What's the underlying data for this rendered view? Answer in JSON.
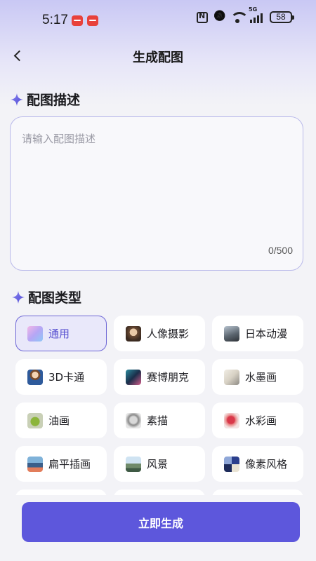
{
  "status_bar": {
    "time": "5:17",
    "battery": "58",
    "network": "5G"
  },
  "header": {
    "title": "生成配图"
  },
  "description": {
    "section_title": "配图描述",
    "placeholder": "请输入配图描述",
    "value": "",
    "char_count": "0/500"
  },
  "types": {
    "section_title": "配图类型",
    "selected": "通用",
    "items": [
      {
        "label": "通用",
        "icon": "general-icon"
      },
      {
        "label": "人像摄影",
        "icon": "portrait-thumb"
      },
      {
        "label": "日本动漫",
        "icon": "anime-thumb"
      },
      {
        "label": "3D卡通",
        "icon": "cartoon-3d-thumb"
      },
      {
        "label": "赛博朋克",
        "icon": "cyberpunk-thumb"
      },
      {
        "label": "水墨画",
        "icon": "ink-wash-thumb"
      },
      {
        "label": "油画",
        "icon": "oil-painting-thumb"
      },
      {
        "label": "素描",
        "icon": "sketch-thumb"
      },
      {
        "label": "水彩画",
        "icon": "watercolor-thumb"
      },
      {
        "label": "扁平插画",
        "icon": "flat-illustration-thumb"
      },
      {
        "label": "风景",
        "icon": "landscape-thumb"
      },
      {
        "label": "像素风格",
        "icon": "pixel-art-thumb"
      }
    ]
  },
  "actions": {
    "generate_label": "立即生成"
  },
  "colors": {
    "accent": "#5d57dc",
    "selected_bg": "#e9e8fa",
    "background": "#f3f3f7"
  }
}
